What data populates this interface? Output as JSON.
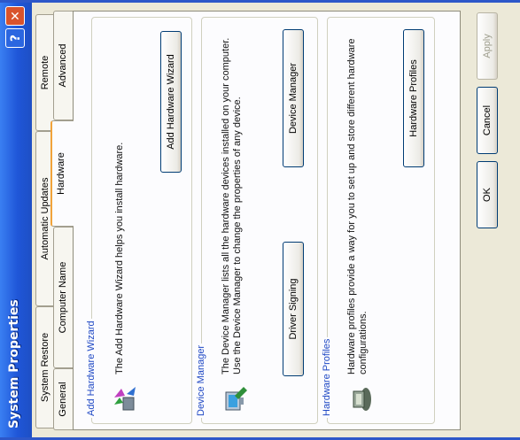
{
  "window": {
    "title": "System Properties",
    "help_label": "?",
    "close_label": "✕"
  },
  "tabs": {
    "row1": [
      "System Restore",
      "Automatic Updates",
      "Remote"
    ],
    "row2": [
      "General",
      "Computer Name",
      "Hardware",
      "Advanced"
    ],
    "selected": "Hardware"
  },
  "add_hardware": {
    "title": "Add Hardware Wizard",
    "description": "The Add Hardware Wizard helps you install hardware.",
    "button": "Add Hardware Wizard",
    "icon": "hardware-wizard-icon"
  },
  "device_manager": {
    "title": "Device Manager",
    "description": "The Device Manager lists all the hardware devices installed on your computer. Use the Device Manager to change the properties of any device.",
    "driver_button": "Driver Signing",
    "device_button": "Device Manager",
    "icon": "device-manager-icon"
  },
  "hardware_profiles": {
    "title": "Hardware Profiles",
    "description": "Hardware profiles provide a way for you to set up and store different hardware configurations.",
    "button": "Hardware Profiles",
    "icon": "hardware-profiles-icon"
  },
  "footer": {
    "ok": "OK",
    "cancel": "Cancel",
    "apply": "Apply"
  },
  "colors": {
    "titlebar": "#1f56d8",
    "group_title": "#1f48c4",
    "selected_tab_accent": "#f1a33b"
  }
}
